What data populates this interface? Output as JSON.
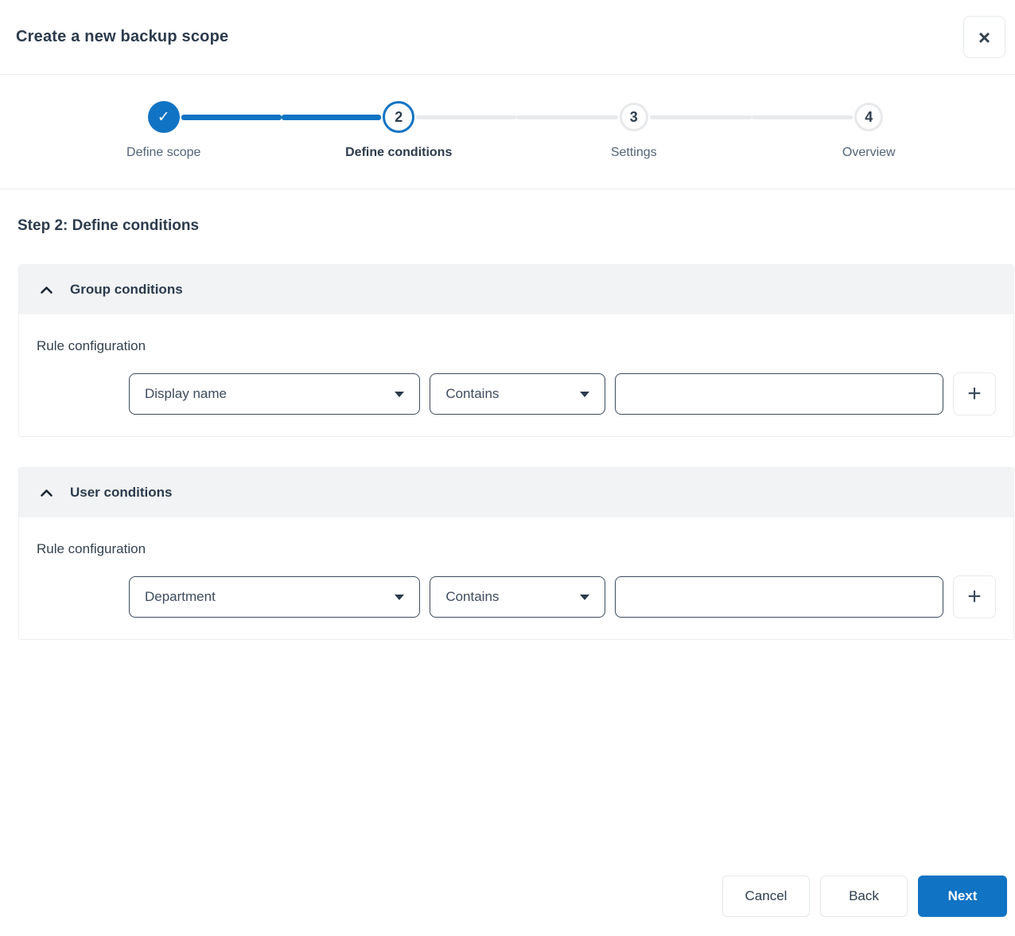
{
  "dialog": {
    "title": "Create a new backup scope",
    "step_heading": "Step 2: Define conditions"
  },
  "icons": {
    "close": "×",
    "check": "✓",
    "plus": "+"
  },
  "stepper": [
    {
      "number": "",
      "label": "Define scope",
      "state": "completed"
    },
    {
      "number": "2",
      "label": "Define conditions",
      "state": "current"
    },
    {
      "number": "3",
      "label": "Settings",
      "state": "upcoming"
    },
    {
      "number": "4",
      "label": "Overview",
      "state": "upcoming"
    }
  ],
  "sections": [
    {
      "title": "Group conditions",
      "rule_label": "Rule configuration",
      "field": "Display name",
      "operator": "Contains",
      "value": ""
    },
    {
      "title": "User conditions",
      "rule_label": "Rule configuration",
      "field": "Department",
      "operator": "Contains",
      "value": ""
    }
  ],
  "footer": {
    "cancel": "Cancel",
    "back": "Back",
    "next": "Next"
  },
  "colors": {
    "accent": "#1173c4",
    "text_dark": "#2c3b4d",
    "section_header_bg": "#f1f3f4"
  }
}
